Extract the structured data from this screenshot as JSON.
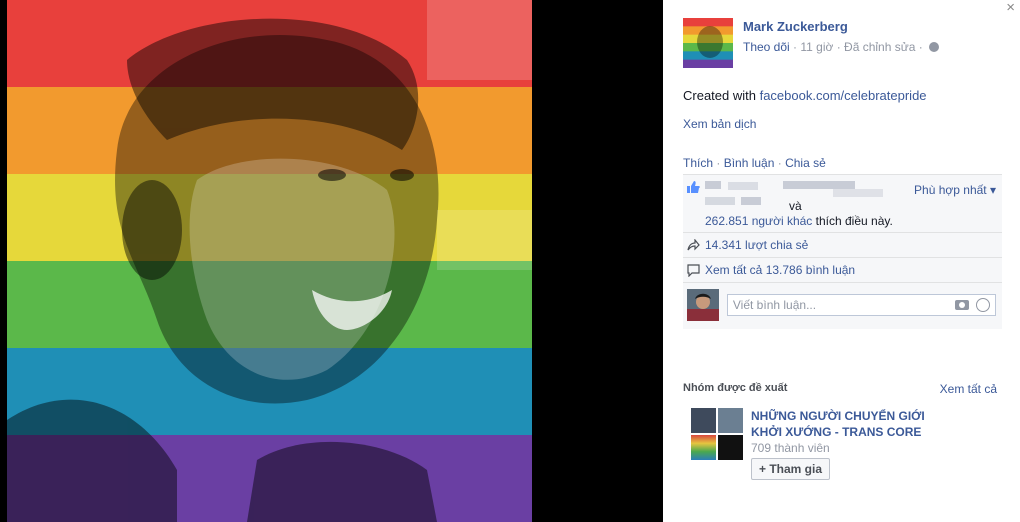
{
  "window": {
    "close_glyph": "×"
  },
  "photo": {
    "stripe_colors": [
      "#e8403c",
      "#f29a2e",
      "#e6d83a",
      "#5bb84a",
      "#1f8fb6",
      "#6a3fa3"
    ]
  },
  "post": {
    "author_name": "Mark Zuckerberg",
    "follow_label": "Theo dõi",
    "sep": " · ",
    "time": "11 giờ",
    "edited": "Đã chỉnh sửa",
    "text_prefix": "Created with ",
    "link": "facebook.com/celebratepride",
    "translate_label": "Xem bản dịch"
  },
  "actions": {
    "like": "Thích",
    "comment": "Bình luận",
    "share": "Chia sẻ",
    "sep": " · "
  },
  "ufi": {
    "sort_label": "Phù hợp nhất ▾",
    "and_label": "và",
    "likes_count": "262.851 người khác",
    "likes_suffix": " thích điều này.",
    "shares": "14.341 lượt chia sẻ",
    "comments": "Xem tất cả 13.786 bình luận",
    "comment_placeholder": "Viết bình luận..."
  },
  "groups": {
    "title": "Nhóm được đề xuất",
    "see_all": "Xem tất cả",
    "name": "NHỮNG NGƯỜI CHUYỂN GIỚI KHỞI XƯỚNG - TRANS CORE",
    "members": "709 thành viên",
    "join_label": "+ Tham gia"
  },
  "colors": {
    "link": "#3b5998",
    "muted": "#9197a3"
  }
}
